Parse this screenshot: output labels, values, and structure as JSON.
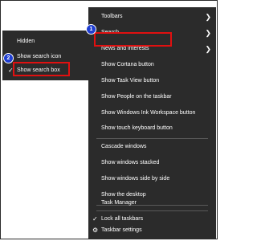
{
  "main_menu": {
    "items": [
      {
        "label": "Toolbars",
        "chevron": "chevron-right-icon"
      },
      {
        "label": "Search",
        "chevron": "chevron-right-icon"
      },
      {
        "label": "News and interests",
        "chevron": "chevron-right-icon"
      },
      {
        "label": "Show Cortana button"
      },
      {
        "label": "Show Task View button"
      },
      {
        "label": "Show People on the taskbar"
      },
      {
        "label": "Show Windows Ink Workspace button"
      },
      {
        "label": "Show touch keyboard button"
      },
      {
        "label": "Cascade windows"
      },
      {
        "label": "Show windows stacked"
      },
      {
        "label": "Show windows side by side"
      },
      {
        "label": "Show the desktop"
      },
      {
        "label": "Task Manager"
      },
      {
        "label": "Lock all taskbars",
        "icon": "check-icon"
      },
      {
        "label": "Taskbar settings",
        "icon": "gear-icon"
      }
    ]
  },
  "sub_menu": {
    "items": [
      {
        "label": "Hidden"
      },
      {
        "label": "Show search icon"
      },
      {
        "label": "Show search box",
        "icon": "check-icon"
      }
    ]
  },
  "badges": {
    "step1": "1",
    "step2": "2"
  },
  "colors": {
    "menu_bg": "#2b2b2b",
    "highlight": "#e01010",
    "badge": "#1f3ed1"
  }
}
